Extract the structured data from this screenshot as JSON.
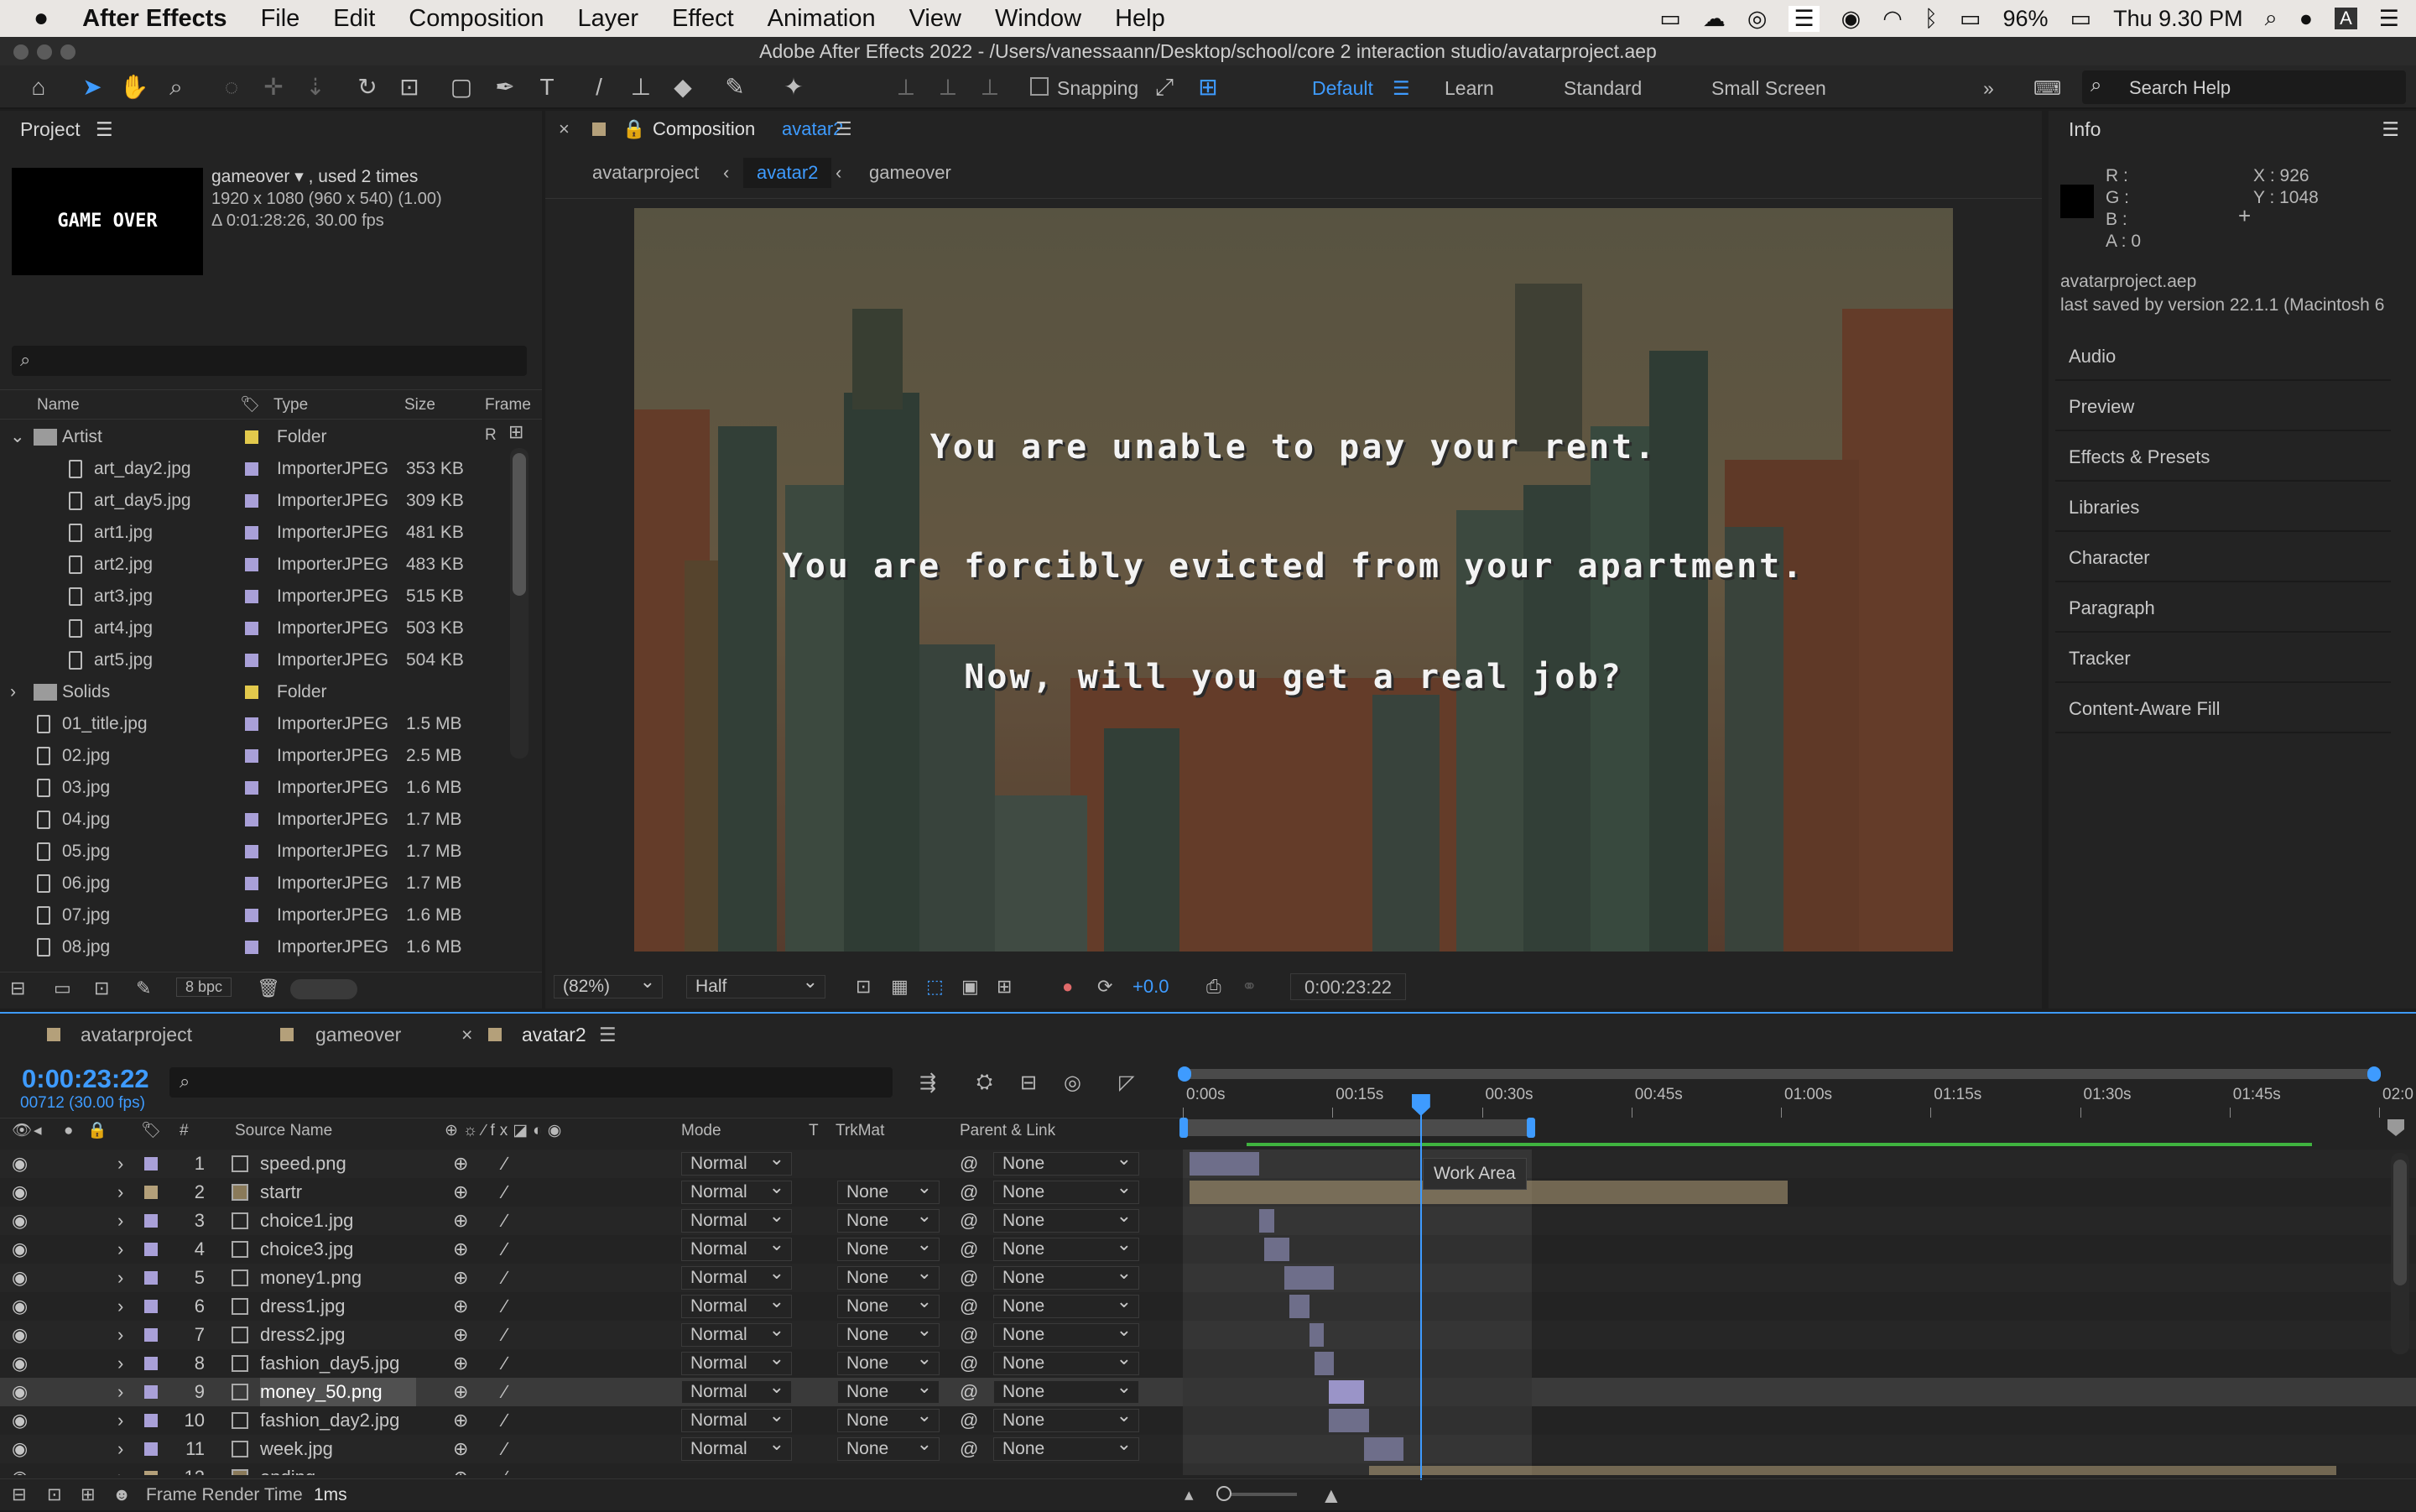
{
  "menubar": {
    "apple": "",
    "app": "After Effects",
    "items": [
      "File",
      "Edit",
      "Composition",
      "Layer",
      "Effect",
      "Animation",
      "View",
      "Window",
      "Help"
    ],
    "battery": "96%",
    "clock": "Thu 9.30 PM"
  },
  "window_title": "Adobe After Effects 2022 - /Users/vanessaann/Desktop/school/core 2 interaction studio/avatarproject.aep",
  "toolbar": {
    "snapping": "Snapping",
    "workspaces": [
      "Default",
      "Learn",
      "Standard",
      "Small Screen"
    ],
    "search_placeholder": "Search Help"
  },
  "project": {
    "title": "Project",
    "item_name": "gameover",
    "used": ", used 2 times",
    "dims": "1920 x 1080  (960 x 540) (1.00)",
    "duration": "Δ 0:01:28:26, 30.00 fps",
    "thumb_text": "GAME OVER",
    "columns": [
      "Name",
      "Type",
      "Size",
      "Frame R"
    ],
    "rows": [
      {
        "name": "Artist",
        "type": "Folder",
        "size": "",
        "kind": "folder",
        "indent": 0,
        "open": true,
        "label": "#e2c94c"
      },
      {
        "name": "art_day2.jpg",
        "type": "ImporterJPEG",
        "size": "353 KB",
        "kind": "file",
        "indent": 1,
        "label": "#a9a0d8"
      },
      {
        "name": "art_day5.jpg",
        "type": "ImporterJPEG",
        "size": "309 KB",
        "kind": "file",
        "indent": 1,
        "label": "#a9a0d8"
      },
      {
        "name": "art1.jpg",
        "type": "ImporterJPEG",
        "size": "481 KB",
        "kind": "file",
        "indent": 1,
        "label": "#a9a0d8"
      },
      {
        "name": "art2.jpg",
        "type": "ImporterJPEG",
        "size": "483 KB",
        "kind": "file",
        "indent": 1,
        "label": "#a9a0d8"
      },
      {
        "name": "art3.jpg",
        "type": "ImporterJPEG",
        "size": "515 KB",
        "kind": "file",
        "indent": 1,
        "label": "#a9a0d8"
      },
      {
        "name": "art4.jpg",
        "type": "ImporterJPEG",
        "size": "503 KB",
        "kind": "file",
        "indent": 1,
        "label": "#a9a0d8"
      },
      {
        "name": "art5.jpg",
        "type": "ImporterJPEG",
        "size": "504 KB",
        "kind": "file",
        "indent": 1,
        "label": "#a9a0d8"
      },
      {
        "name": "Solids",
        "type": "Folder",
        "size": "",
        "kind": "folder",
        "indent": 0,
        "open": false,
        "label": "#e2c94c"
      },
      {
        "name": "01_title.jpg",
        "type": "ImporterJPEG",
        "size": "1.5 MB",
        "kind": "file",
        "indent": 0,
        "label": "#a9a0d8"
      },
      {
        "name": "02.jpg",
        "type": "ImporterJPEG",
        "size": "2.5 MB",
        "kind": "file",
        "indent": 0,
        "label": "#a9a0d8"
      },
      {
        "name": "03.jpg",
        "type": "ImporterJPEG",
        "size": "1.6 MB",
        "kind": "file",
        "indent": 0,
        "label": "#a9a0d8"
      },
      {
        "name": "04.jpg",
        "type": "ImporterJPEG",
        "size": "1.7 MB",
        "kind": "file",
        "indent": 0,
        "label": "#a9a0d8"
      },
      {
        "name": "05.jpg",
        "type": "ImporterJPEG",
        "size": "1.7 MB",
        "kind": "file",
        "indent": 0,
        "label": "#a9a0d8"
      },
      {
        "name": "06.jpg",
        "type": "ImporterJPEG",
        "size": "1.7 MB",
        "kind": "file",
        "indent": 0,
        "label": "#a9a0d8"
      },
      {
        "name": "07.jpg",
        "type": "ImporterJPEG",
        "size": "1.6 MB",
        "kind": "file",
        "indent": 0,
        "label": "#a9a0d8"
      },
      {
        "name": "08.jpg",
        "type": "ImporterJPEG",
        "size": "1.6 MB",
        "kind": "file",
        "indent": 0,
        "label": "#a9a0d8"
      }
    ],
    "bpc": "8 bpc"
  },
  "composition": {
    "title": "Composition",
    "name": "avatar2",
    "breadcrumbs": [
      "avatarproject",
      "avatar2",
      "gameover"
    ],
    "lines": [
      "You are unable to pay your rent.",
      "You are forcibly evicted from your apartment.",
      "Now, will you get a real job?"
    ],
    "zoom": "(82%)",
    "resolution": "Half",
    "exposure": "+0.0",
    "timecode": "0:00:23:22"
  },
  "info": {
    "title": "Info",
    "r": "R :",
    "g": "G :",
    "b": "B :",
    "a": "A :  0",
    "x": "X : 926",
    "y": "Y : 1048",
    "file": "avatarproject.aep",
    "saved": "last saved by version 22.1.1 (Macintosh 6",
    "panels": [
      "Audio",
      "Preview",
      "Effects & Presets",
      "Libraries",
      "Character",
      "Paragraph",
      "Tracker",
      "Content-Aware Fill"
    ]
  },
  "timeline": {
    "tabs": [
      "avatarproject",
      "gameover",
      "avatar2"
    ],
    "timecode": "0:00:23:22",
    "frames": "00712 (30.00 fps)",
    "columns": {
      "num": "#",
      "source": "Source Name",
      "mode": "Mode",
      "t": "T",
      "trkmat": "TrkMat",
      "parent": "Parent & Link"
    },
    "ruler": [
      "0:00s",
      "00:15s",
      "00:30s",
      "00:45s",
      "01:00s",
      "01:15s",
      "01:30s",
      "01:45s",
      "02:0"
    ],
    "tooltip": "Work Area",
    "layers": [
      {
        "num": "1",
        "name": "speed.png",
        "mode": "Normal",
        "trkmat": "",
        "parent": "None",
        "color": "#a9a0d8",
        "icon": "file",
        "start": 0,
        "end": 7
      },
      {
        "num": "2",
        "name": "startr",
        "mode": "Normal",
        "trkmat": "None",
        "parent": "None",
        "color": "#b4a07a",
        "icon": "comp",
        "start": 0,
        "end": 60
      },
      {
        "num": "3",
        "name": "choice1.jpg",
        "mode": "Normal",
        "trkmat": "None",
        "parent": "None",
        "color": "#a9a0d8",
        "icon": "file",
        "start": 7,
        "end": 8.5
      },
      {
        "num": "4",
        "name": "choice3.jpg",
        "mode": "Normal",
        "trkmat": "None",
        "parent": "None",
        "color": "#a9a0d8",
        "icon": "file",
        "start": 7.5,
        "end": 10
      },
      {
        "num": "5",
        "name": "money1.png",
        "mode": "Normal",
        "trkmat": "None",
        "parent": "None",
        "color": "#a9a0d8",
        "icon": "file",
        "start": 9.5,
        "end": 14.5
      },
      {
        "num": "6",
        "name": "dress1.jpg",
        "mode": "Normal",
        "trkmat": "None",
        "parent": "None",
        "color": "#a9a0d8",
        "icon": "file",
        "start": 10,
        "end": 12
      },
      {
        "num": "7",
        "name": "dress2.jpg",
        "mode": "Normal",
        "trkmat": "None",
        "parent": "None",
        "color": "#a9a0d8",
        "icon": "file",
        "start": 12,
        "end": 13.5
      },
      {
        "num": "8",
        "name": "fashion_day5.jpg",
        "mode": "Normal",
        "trkmat": "None",
        "parent": "None",
        "color": "#a9a0d8",
        "icon": "file",
        "start": 12.5,
        "end": 14.5
      },
      {
        "num": "9",
        "name": "money_50.png",
        "mode": "Normal",
        "trkmat": "None",
        "parent": "None",
        "color": "#a9a0d8",
        "icon": "file",
        "start": 14,
        "end": 17.5,
        "selected": true
      },
      {
        "num": "10",
        "name": "fashion_day2.jpg",
        "mode": "Normal",
        "trkmat": "None",
        "parent": "None",
        "color": "#a9a0d8",
        "icon": "file",
        "start": 14,
        "end": 18
      },
      {
        "num": "11",
        "name": "week.jpg",
        "mode": "Normal",
        "trkmat": "None",
        "parent": "None",
        "color": "#a9a0d8",
        "icon": "file",
        "start": 17.5,
        "end": 21.5
      },
      {
        "num": "12",
        "name": "ending",
        "mode": "",
        "trkmat": "",
        "parent": "",
        "color": "#b4a07a",
        "icon": "comp",
        "start": 18,
        "end": 115
      }
    ],
    "workarea_end_s": 35,
    "playhead_s": 23.8,
    "render_label": "Frame Render Time",
    "render_value": "1ms"
  }
}
